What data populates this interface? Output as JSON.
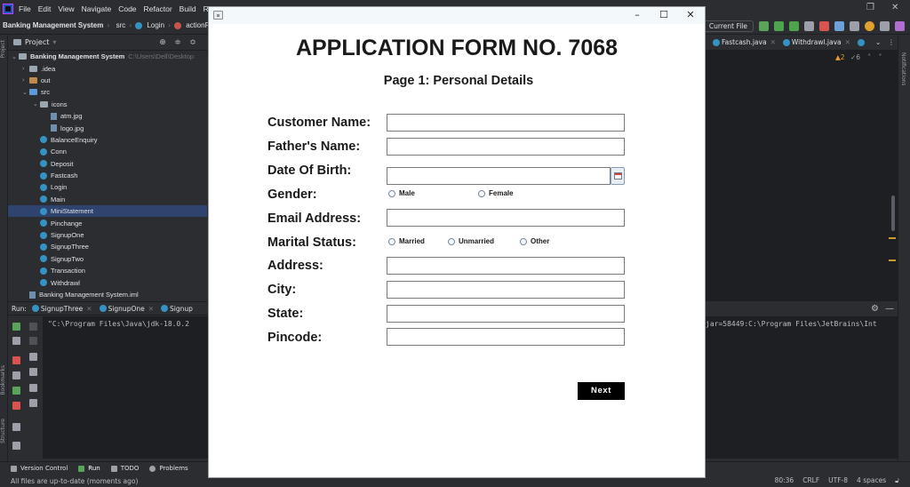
{
  "ide": {
    "menu": [
      "File",
      "Edit",
      "View",
      "Navigate",
      "Code",
      "Refactor",
      "Build",
      "R"
    ],
    "breadcrumb": {
      "project": "Banking Management System",
      "module": "src",
      "class": "Login",
      "method": "actionPer"
    },
    "run_config": "Current File",
    "project_panel": {
      "title": "Project",
      "tree": [
        {
          "label": "Banking Management System",
          "path": "C:\\Users\\Dell\\Desktop",
          "kind": "root",
          "indent": 0
        },
        {
          "label": ".idea",
          "kind": "folder",
          "indent": 1
        },
        {
          "label": "out",
          "kind": "folder-orange",
          "indent": 1
        },
        {
          "label": "src",
          "kind": "folder-blue",
          "indent": 1
        },
        {
          "label": "icons",
          "kind": "folder",
          "indent": 2
        },
        {
          "label": "atm.jpg",
          "kind": "file",
          "indent": 3
        },
        {
          "label": "logo.jpg",
          "kind": "file",
          "indent": 3
        },
        {
          "label": "BalanceEnquiry",
          "kind": "class",
          "indent": 2
        },
        {
          "label": "Conn",
          "kind": "class",
          "indent": 2
        },
        {
          "label": "Deposit",
          "kind": "class",
          "indent": 2
        },
        {
          "label": "Fastcash",
          "kind": "class",
          "indent": 2
        },
        {
          "label": "Login",
          "kind": "class",
          "indent": 2
        },
        {
          "label": "Main",
          "kind": "class",
          "indent": 2
        },
        {
          "label": "MiniStatement",
          "kind": "class",
          "indent": 2,
          "selected": true
        },
        {
          "label": "Pinchange",
          "kind": "class",
          "indent": 2
        },
        {
          "label": "SignupOne",
          "kind": "class",
          "indent": 2
        },
        {
          "label": "SignupThree",
          "kind": "class",
          "indent": 2
        },
        {
          "label": "SignupTwo",
          "kind": "class",
          "indent": 2
        },
        {
          "label": "Transaction",
          "kind": "class",
          "indent": 2
        },
        {
          "label": "Withdrawl",
          "kind": "class",
          "indent": 2
        },
        {
          "label": "Banking Management System.iml",
          "kind": "file",
          "indent": 1
        }
      ]
    },
    "editor_tabs": [
      "Fastcash.java",
      "Withdrawl.java"
    ],
    "inspections": {
      "warnings": "2",
      "weak": "6"
    },
    "run_panel": {
      "label": "Run:",
      "tabs": [
        "SignupThree",
        "SignupOne",
        "Signup"
      ],
      "console_left": "\"C:\\Program Files\\Java\\jdk-18.0.2",
      "console_right": "jar=58449:C:\\Program Files\\JetBrains\\Int"
    },
    "bottom_tabs": [
      "Version Control",
      "Run",
      "TODO",
      "Problems"
    ],
    "side_labels": {
      "project": "Project",
      "bookmarks": "Bookmarks",
      "structure": "Structure",
      "notifications": "Notifications"
    },
    "status": {
      "message": "All files are up-to-date (moments ago)",
      "position": "80:36",
      "line_sep": "CRLF",
      "encoding": "UTF-8",
      "indent": "4 spaces"
    }
  },
  "form": {
    "title": "APPLICATION FORM NO. 7068",
    "subtitle": "Page 1: Personal Details",
    "labels": {
      "name": "Customer Name:",
      "father": "Father's Name:",
      "dob": "Date Of Birth:",
      "gender": "Gender:",
      "email": "Email Address:",
      "marital": "Marital Status:",
      "address": "Address:",
      "city": "City:",
      "state": "State:",
      "pincode": "Pincode:"
    },
    "values": {
      "name": "",
      "father": "",
      "dob": "",
      "email": "",
      "address": "",
      "city": "",
      "state": "",
      "pincode": ""
    },
    "gender_options": [
      "Male",
      "Female"
    ],
    "marital_options": [
      "Married",
      "Unmarried",
      "Other"
    ],
    "next_label": "Next"
  },
  "colors": {
    "ide_bg": "#2b2d30",
    "selection": "#2e436e",
    "accent_orange": "#e0a030",
    "form_bg": "#ffffff",
    "button_bg": "#000000"
  }
}
